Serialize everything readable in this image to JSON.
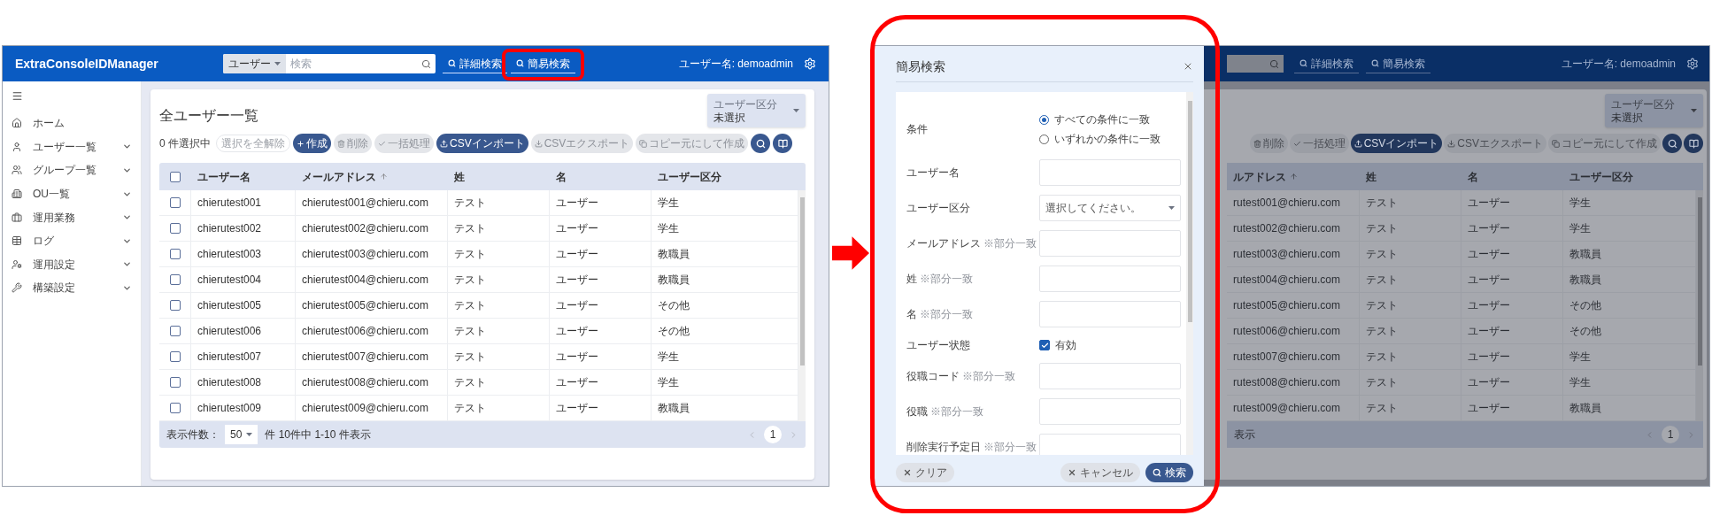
{
  "left_screen": {
    "app_title": "ExtraConsoleIDManager",
    "search": {
      "scope": "ユーザー",
      "placeholder": "検索"
    },
    "header_links": [
      {
        "label": "詳細検索",
        "highlighted": false
      },
      {
        "label": "簡易検索",
        "highlighted": true
      }
    ],
    "user_label": "ユーザー名: demoadmin",
    "sidebar": [
      {
        "label": "ホーム",
        "expandable": false
      },
      {
        "label": "ユーザー一覧",
        "expandable": true
      },
      {
        "label": "グループ一覧",
        "expandable": true
      },
      {
        "label": "OU一覧",
        "expandable": true
      },
      {
        "label": "運用業務",
        "expandable": true
      },
      {
        "label": "ログ",
        "expandable": true
      },
      {
        "label": "運用設定",
        "expandable": true
      },
      {
        "label": "構築設定",
        "expandable": true
      }
    ],
    "page_title": "全ユーザー一覧",
    "filter": {
      "label": "ユーザー区分",
      "value": "未選択"
    },
    "selection_count": "0 件選択中",
    "clear_selection": {
      "label": "選択を全解除",
      "disabled": true
    },
    "actions": [
      {
        "kind": "create",
        "label": "作成",
        "disabled": false
      },
      {
        "kind": "delete",
        "label": "削除",
        "disabled": true
      },
      {
        "kind": "bulk",
        "label": "一括処理",
        "disabled": true
      },
      {
        "kind": "import",
        "label": "CSVインポート",
        "disabled": false
      },
      {
        "kind": "export",
        "label": "CSVエクスポート",
        "disabled": true
      },
      {
        "kind": "copy",
        "label": "コピー元にして作成",
        "disabled": true
      }
    ],
    "table": {
      "all_checked": false,
      "columns": [
        {
          "label": "ユーザー名",
          "sorted": false
        },
        {
          "label": "メールアドレス",
          "sorted": true
        },
        {
          "label": "姓",
          "sorted": false
        },
        {
          "label": "名",
          "sorted": false
        },
        {
          "label": "ユーザー区分",
          "sorted": false
        }
      ],
      "rows": [
        {
          "checked": false,
          "cells": [
            "chierutest001",
            "chierutest001@chieru.com",
            "テスト",
            "ユーザー",
            "学生"
          ]
        },
        {
          "checked": false,
          "cells": [
            "chierutest002",
            "chierutest002@chieru.com",
            "テスト",
            "ユーザー",
            "学生"
          ]
        },
        {
          "checked": false,
          "cells": [
            "chierutest003",
            "chierutest003@chieru.com",
            "テスト",
            "ユーザー",
            "教職員"
          ]
        },
        {
          "checked": false,
          "cells": [
            "chierutest004",
            "chierutest004@chieru.com",
            "テスト",
            "ユーザー",
            "教職員"
          ]
        },
        {
          "checked": false,
          "cells": [
            "chierutest005",
            "chierutest005@chieru.com",
            "テスト",
            "ユーザー",
            "その他"
          ]
        },
        {
          "checked": false,
          "cells": [
            "chierutest006",
            "chierutest006@chieru.com",
            "テスト",
            "ユーザー",
            "その他"
          ]
        },
        {
          "checked": false,
          "cells": [
            "chierutest007",
            "chierutest007@chieru.com",
            "テスト",
            "ユーザー",
            "学生"
          ]
        },
        {
          "checked": false,
          "cells": [
            "chierutest008",
            "chierutest008@chieru.com",
            "テスト",
            "ユーザー",
            "学生"
          ]
        },
        {
          "checked": false,
          "cells": [
            "chierutest009",
            "chierutest009@chieru.com",
            "テスト",
            "ユーザー",
            "教職員"
          ]
        }
      ]
    },
    "footer": {
      "page_size_label": "表示件数：",
      "page_size": "50",
      "range": "件 10件中 1-10 件表示",
      "pages": [
        {
          "label": "1",
          "selected": true
        }
      ]
    }
  },
  "right_screen": {
    "background": {
      "header_links": [
        {
          "label": "詳細検索"
        },
        {
          "label": "簡易検索"
        }
      ],
      "user_label": "ユーザー名: demoadmin",
      "filter": {
        "label": "ユーザー区分",
        "value": "未選択"
      },
      "actions": [
        {
          "kind": "delete",
          "label": "削除",
          "disabled": true
        },
        {
          "kind": "bulk",
          "label": "一括処理",
          "disabled": true
        },
        {
          "kind": "import",
          "label": "CSVインポート",
          "disabled": false
        },
        {
          "kind": "export",
          "label": "CSVエクスポート",
          "disabled": true
        },
        {
          "kind": "copy",
          "label": "コピー元にして作成",
          "disabled": true
        }
      ],
      "columns": [
        {
          "label": "ルアドレス",
          "sorted": true
        },
        {
          "label": "姓",
          "sorted": false
        },
        {
          "label": "名",
          "sorted": false
        },
        {
          "label": "ユーザー区分",
          "sorted": false
        }
      ],
      "rows": [
        [
          "rutest001@chieru.com",
          "テスト",
          "ユーザー",
          "学生"
        ],
        [
          "rutest002@chieru.com",
          "テスト",
          "ユーザー",
          "学生"
        ],
        [
          "rutest003@chieru.com",
          "テスト",
          "ユーザー",
          "教職員"
        ],
        [
          "rutest004@chieru.com",
          "テスト",
          "ユーザー",
          "教職員"
        ],
        [
          "rutest005@chieru.com",
          "テスト",
          "ユーザー",
          "その他"
        ],
        [
          "rutest006@chieru.com",
          "テスト",
          "ユーザー",
          "その他"
        ],
        [
          "rutest007@chieru.com",
          "テスト",
          "ユーザー",
          "学生"
        ],
        [
          "rutest008@chieru.com",
          "テスト",
          "ユーザー",
          "学生"
        ],
        [
          "rutest009@chieru.com",
          "テスト",
          "ユーザー",
          "教職員"
        ]
      ],
      "footer_text": "表示",
      "pages": [
        {
          "label": "1",
          "selected": true
        }
      ]
    },
    "dialog": {
      "title": "簡易検索",
      "fields": [
        {
          "kind": "radio",
          "label": "条件",
          "options": [
            {
              "label": "すべての条件に一致",
              "selected": true
            },
            {
              "label": "いずれかの条件に一致",
              "selected": false
            }
          ]
        },
        {
          "kind": "text",
          "label": "ユーザー名"
        },
        {
          "kind": "select",
          "label": "ユーザー区分",
          "placeholder": "選択してください。"
        },
        {
          "kind": "text",
          "label": "メールアドレス",
          "note": "※部分一致"
        },
        {
          "kind": "text",
          "label": "姓",
          "note": "※部分一致"
        },
        {
          "kind": "text",
          "label": "名",
          "note": "※部分一致"
        },
        {
          "kind": "checkbox",
          "label": "ユーザー状態",
          "option": "有効",
          "checked": true
        },
        {
          "kind": "text",
          "label": "役職コード",
          "note": "※部分一致"
        },
        {
          "kind": "text",
          "label": "役職",
          "note": "※部分一致"
        },
        {
          "kind": "text",
          "label": "削除実行予定日",
          "note": "※部分一致"
        }
      ],
      "buttons": [
        {
          "kind": "clear",
          "label": "クリア"
        },
        {
          "kind": "cancel",
          "label": "キャンセル"
        },
        {
          "kind": "submit",
          "label": "検索"
        }
      ]
    }
  }
}
